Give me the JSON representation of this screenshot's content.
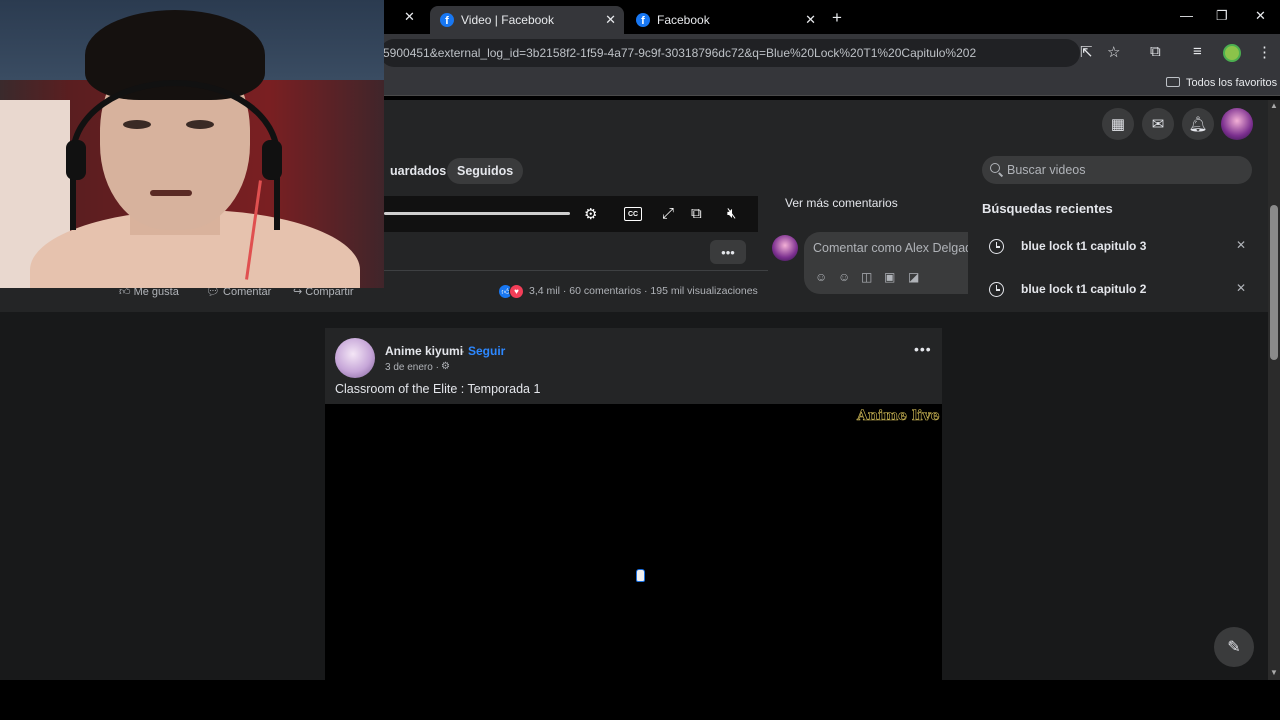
{
  "browser": {
    "tabs": [
      {
        "label": "Video | Facebook",
        "active": true
      },
      {
        "label": "Facebook",
        "active": false
      }
    ],
    "url": "5900451&external_log_id=3b2158f2-1f59-4a77-9c9f-30318796dc72&q=Blue%20Lock%20T1%20Capitulo%202",
    "bookmarks_label": "Todos los favoritos"
  },
  "page": {
    "nav_pills": {
      "saved_partial": "uardados",
      "following": "Seguidos"
    },
    "feed_actions": {
      "like": "Me gusta",
      "comment": "Comentar",
      "share": "Compartir"
    },
    "stats": {
      "reactions": "3,4 mil",
      "comments": "60 comentarios",
      "views": "195 mil visualizaciones"
    },
    "comments": {
      "see_more": "Ver más comentarios",
      "placeholder": "Comentar como Alex Delgado"
    },
    "search": {
      "placeholder": "Buscar videos",
      "recent_title": "Búsquedas recientes",
      "recent": [
        "blue lock t1 capitulo 3",
        "blue lock t1 capitulo 2"
      ]
    },
    "post": {
      "author": "Anime kiyumi",
      "separator": "·",
      "follow": "Seguir",
      "date": "3 de enero ·",
      "caption": "Classroom of the Elite : Temporada 1",
      "watermark": "Anime live"
    }
  },
  "icons": {
    "apps": "grid-icon",
    "messenger": "messenger-icon",
    "notifications": "bell-icon",
    "compose": "compose-icon",
    "settings": "gear-icon"
  }
}
